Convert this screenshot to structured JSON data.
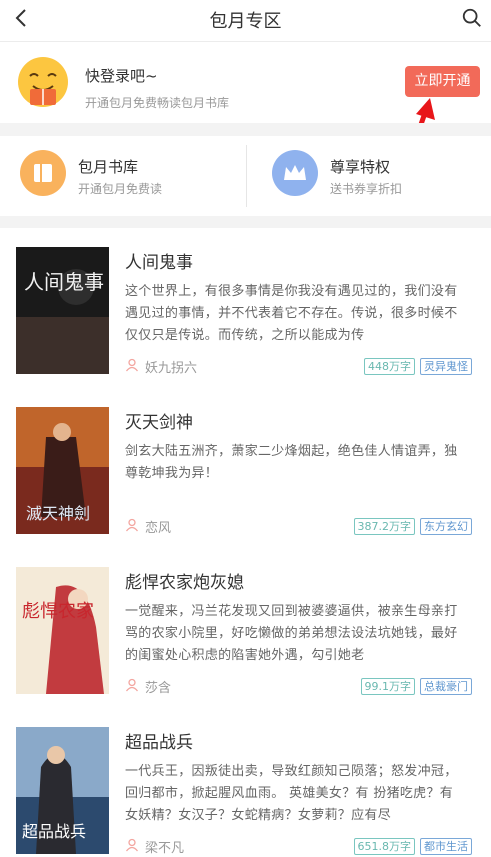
{
  "header": {
    "title": "包月专区",
    "back_icon": "back-chevron-icon",
    "search_icon": "search-icon"
  },
  "login": {
    "title": "快登录吧~",
    "subtitle": "开通包月免费畅读包月书库",
    "button": "立即开通"
  },
  "features": [
    {
      "name": "包月书库",
      "desc": "开通包月免费读",
      "icon": "book-icon"
    },
    {
      "name": "尊享特权",
      "desc": "送书券享折扣",
      "icon": "crown-icon"
    }
  ],
  "books": [
    {
      "title": "人间鬼事",
      "desc": "这个世界上，有很多事情是你我没有遇见过的，我们没有遇见过的事情，并不代表着它不存在。传说，很多时候不仅仅只是传说。而传统，之所以能成为传",
      "author": "妖九拐六",
      "words": "448万字",
      "category": "灵异鬼怪",
      "cover_text": "人间鬼事"
    },
    {
      "title": "灭天剑神",
      "desc": "剑玄大陆五洲齐，萧家二少烽烟起，绝色佳人情谊弄，独尊乾坤我为异！",
      "author": "恋风",
      "words": "387.2万字",
      "category": "东方玄幻",
      "cover_text": "滅天神劍"
    },
    {
      "title": "彪悍农家炮灰媳",
      "desc": "一觉醒来，冯兰花发现又回到被婆婆逼供，被亲生母亲打骂的农家小院里，好吃懒做的弟弟想法设法坑她钱，最好的闺蜜处心积虑的陷害她外遇，勾引她老",
      "author": "莎含",
      "words": "99.1万字",
      "category": "总裁豪门",
      "cover_text": "彪悍农家"
    },
    {
      "title": "超品战兵",
      "desc": "一代兵王，因叛徒出卖，导致红颜知己陨落；怒发冲冠，回归都市，掀起腥风血雨。 英雄美女？有 扮猪吃虎？有 女妖精？女汉子？女蛇精病？女萝莉？应有尽",
      "author": "梁不凡",
      "words": "651.8万字",
      "category": "都市生活",
      "cover_text": "超品战兵"
    }
  ],
  "colors": {
    "accent": "#f26a59",
    "word_tag": "#6ab8b0",
    "category_tag": "#5f96cf",
    "gap": "#f3f3f3"
  }
}
